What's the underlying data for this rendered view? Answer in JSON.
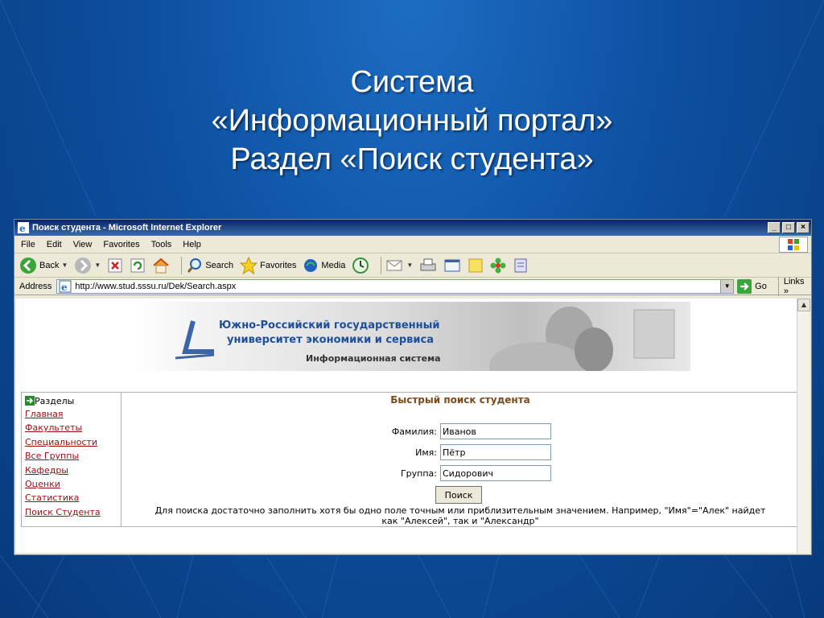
{
  "slide": {
    "title_line1": "Система",
    "title_line2": "«Информационный портал»",
    "title_line3": "Раздел «Поиск студента»"
  },
  "window": {
    "title": "Поиск студента - Microsoft Internet Explorer",
    "buttons": {
      "minimize": "_",
      "maximize": "□",
      "close": "×"
    }
  },
  "menu": [
    "File",
    "Edit",
    "View",
    "Favorites",
    "Tools",
    "Help"
  ],
  "toolbar": {
    "back": "Back",
    "search": "Search",
    "favorites": "Favorites",
    "media": "Media"
  },
  "address": {
    "label": "Address",
    "url": "http://www.stud.sssu.ru/Dek/Search.aspx",
    "go": "Go",
    "links": "Links"
  },
  "banner": {
    "line1": "Южно-Российский государственный",
    "line2": "университет экономики и сервиса",
    "line3": "Информационная система"
  },
  "sidebar": {
    "section": "Разделы",
    "items": [
      "Главная",
      "Факультеты",
      "Специальности",
      "Все Группы",
      "Кафедры",
      "Оценки",
      "Статистика",
      "Поиск Студента"
    ]
  },
  "search": {
    "title": "Быстрый поиск студента",
    "surname_label": "Фамилия:",
    "surname_value": "Иванов",
    "name_label": "Имя:",
    "name_value": "Пётр",
    "group_label": "Группа:",
    "group_value": "Сидорович",
    "button": "Поиск",
    "hint_line1": "Для поиска достаточно заполнить хотя бы одно поле точным или приблизительным значением. Например, \"Имя\"=\"Алек\" найдет",
    "hint_line2": "как \"Алексей\", так и \"Александр\""
  },
  "colors": {
    "slide_bg": "#0d4fa0",
    "link": "#a01010",
    "search_title": "#7a4a18",
    "banner_text": "#1d4f9a"
  }
}
